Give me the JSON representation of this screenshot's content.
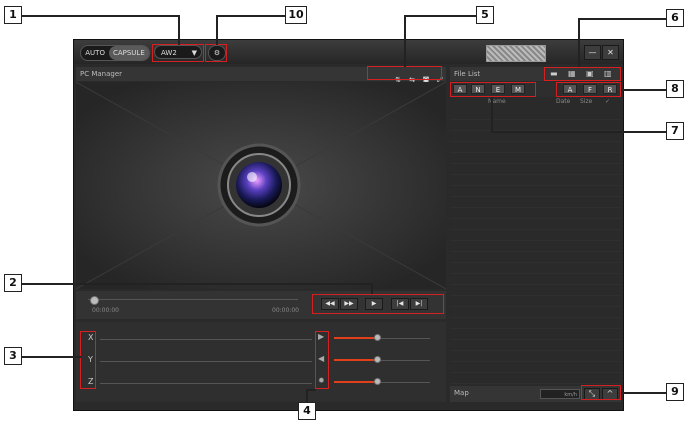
{
  "callouts": [
    "1",
    "2",
    "3",
    "4",
    "5",
    "6",
    "7",
    "8",
    "9",
    "10"
  ],
  "topbar": {
    "mode_auto": "AUTO",
    "mode_capsule": "CAPSULE",
    "model_value": "AW2",
    "dropdown_icon": "chevron-down-icon",
    "settings_icon": "gear-icon",
    "minimize_label": "—",
    "close_label": "✕"
  },
  "left_panel": {
    "title": "PC Manager",
    "toolbar_icons": [
      "flip-vertical-icon",
      "flip-horizontal-icon",
      "camera-icon",
      "fullscreen-icon"
    ],
    "time_start": "00:00:00",
    "time_end": "00:00:00",
    "playback_buttons": [
      "◀◀",
      "▶▶",
      "▶",
      "|◀",
      "▶|"
    ]
  },
  "gsensor": {
    "axes": [
      "X",
      "Y",
      "Z"
    ],
    "controls": [
      {
        "icon": "speed-icon",
        "level": 0.45
      },
      {
        "icon": "volume-icon",
        "level": 0.45
      },
      {
        "icon": "brightness-icon",
        "level": 0.45
      }
    ]
  },
  "right_panel": {
    "title": "File List",
    "file_toolbar_icons": [
      "folder-icon",
      "calendar-icon",
      "save-icon",
      "delete-icon"
    ],
    "filters_left": [
      "A",
      "N",
      "E",
      "M"
    ],
    "filters_right": [
      "A",
      "F",
      "R"
    ],
    "columns": {
      "name": "Name",
      "date": "Date",
      "size": "Size",
      "check": "✓"
    },
    "map_label": "Map",
    "speed_unit": "km/h",
    "map_expand": "⤡",
    "map_collapse": "^"
  },
  "colors": {
    "highlight": "#d42020",
    "accent": "#e0401a",
    "window_bg": "#2a2a2a"
  }
}
